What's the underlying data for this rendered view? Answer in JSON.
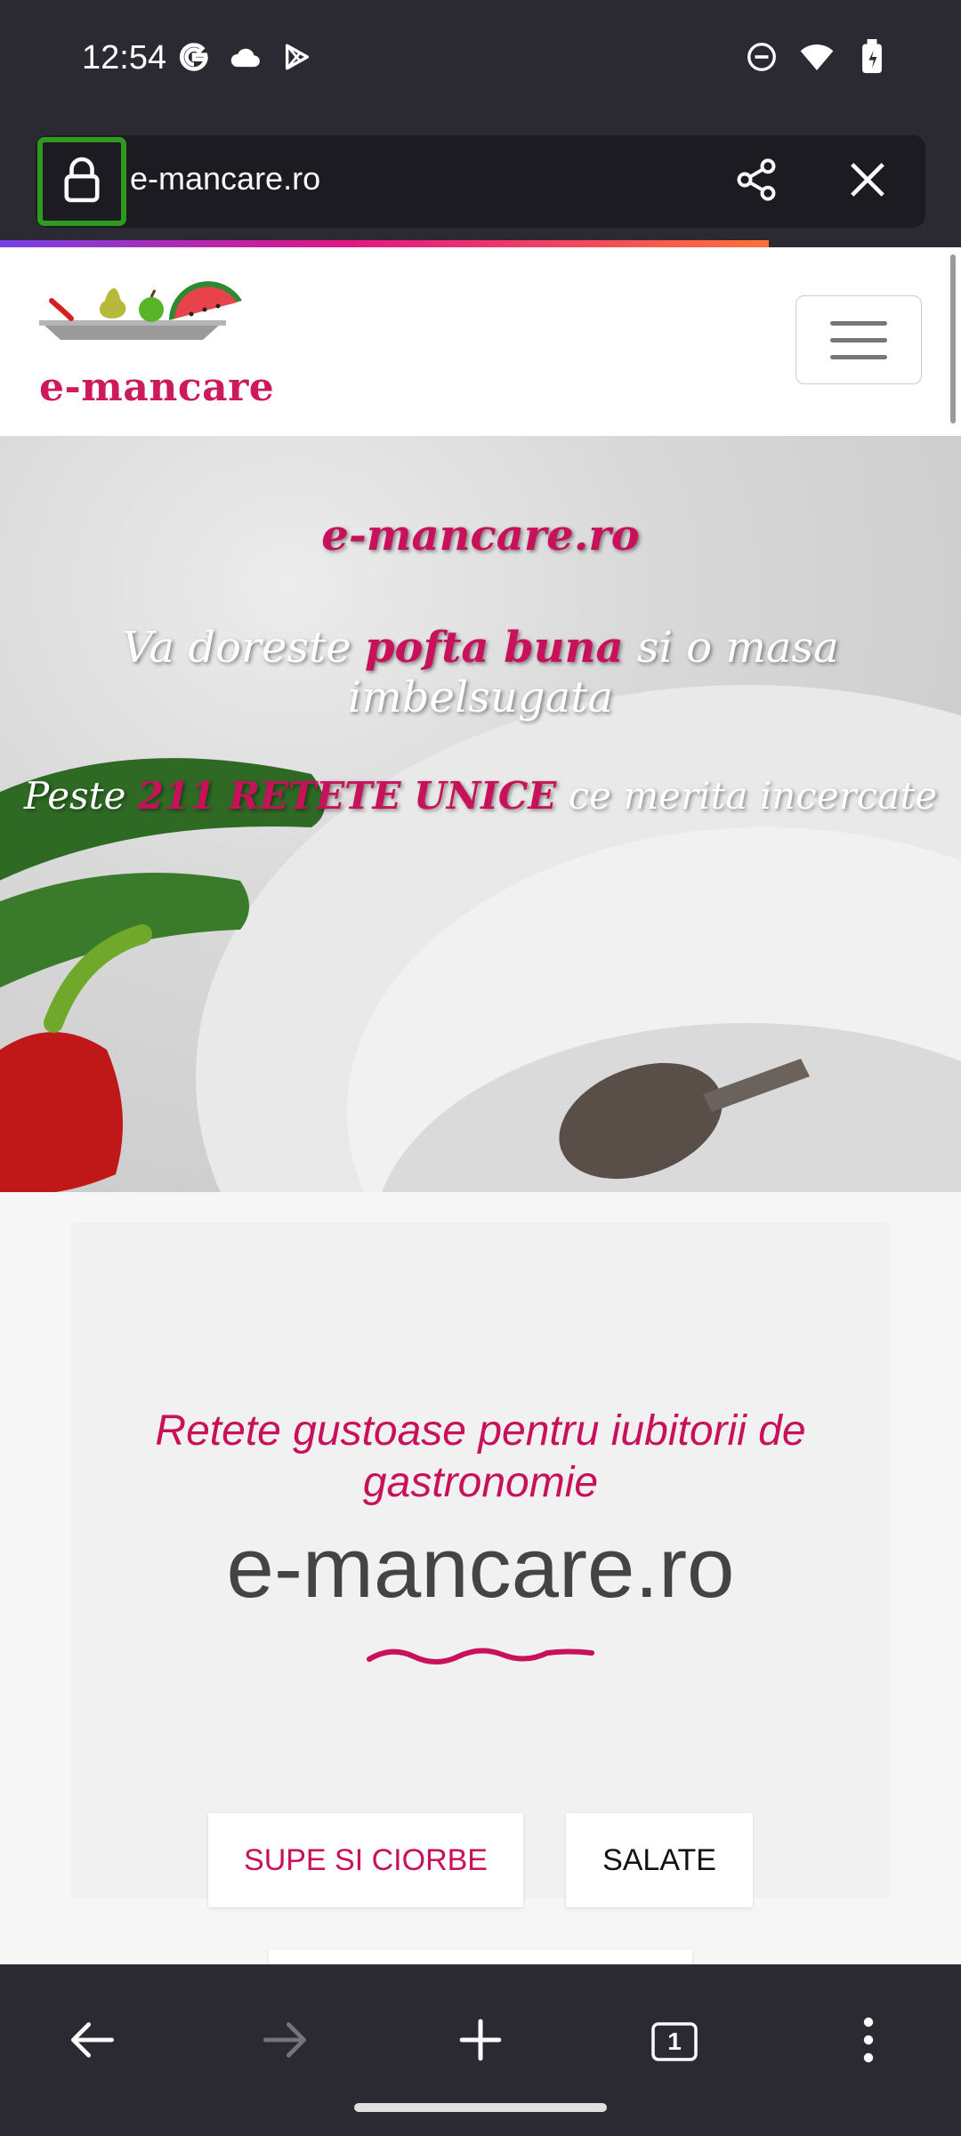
{
  "status_bar": {
    "time": "12:54",
    "left_icons": [
      "google-icon",
      "cloud-icon",
      "play-store-icon"
    ],
    "right_icons": [
      "do-not-disturb-icon",
      "wifi-icon",
      "battery-icon"
    ]
  },
  "url_bar": {
    "url": "e-mancare.ro",
    "lock_icon": "lock-icon",
    "share_icon": "share-icon",
    "close_icon": "close-icon",
    "load_progress_percent": 80
  },
  "site": {
    "logo_text": "e-mancare",
    "menu_icon": "hamburger-menu-icon"
  },
  "hero": {
    "title": "e-mancare.ro",
    "line1_a": "Va doreste ",
    "line1_b": "pofta buna",
    "line1_c": " si o masa imbelsugata",
    "line2_a": "Peste ",
    "line2_b": "211 RETETE UNICE",
    "line2_c": " ce merita incercate"
  },
  "intro": {
    "tagline": "Retete gustoase pentru iubitorii de gastronomie",
    "title": "e-mancare.ro"
  },
  "categories": [
    "SUPE SI CIORBE",
    "SALATE"
  ],
  "toolbar": {
    "back_icon": "back-arrow-icon",
    "forward_icon": "forward-arrow-icon",
    "new_tab_icon": "plus-icon",
    "tabs_count": "1",
    "menu_icon": "more-vert-icon"
  },
  "colors": {
    "accent": "#c8115a",
    "chrome_bg": "#2b2a33",
    "lock_highlight": "#2f9a1d"
  }
}
